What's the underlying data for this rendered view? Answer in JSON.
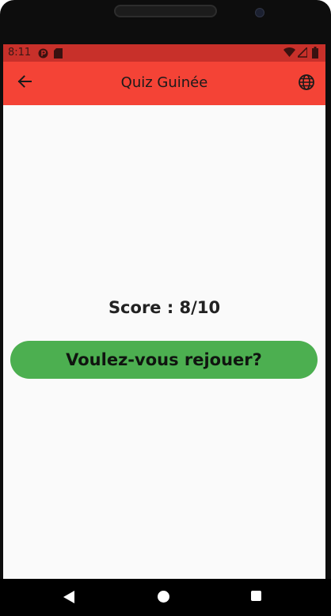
{
  "status_bar": {
    "time": "8:11",
    "left_icons": [
      "p-circle-icon",
      "sd-card-icon"
    ],
    "right_icons": [
      "wifi-icon",
      "signal-icon",
      "battery-icon"
    ],
    "background_color": "#c8302a"
  },
  "app_bar": {
    "title": "Quiz Guinée",
    "back_icon": "arrow-left-icon",
    "action_icon": "globe-icon",
    "background_color": "#f44336"
  },
  "result": {
    "score_text": "Score : 8/10",
    "replay_button_label": "Voulez-vous rejouer?",
    "button_color": "#4caf50"
  },
  "nav_bar": {
    "icons": [
      "back-triangle-icon",
      "home-circle-icon",
      "recents-square-icon"
    ]
  }
}
